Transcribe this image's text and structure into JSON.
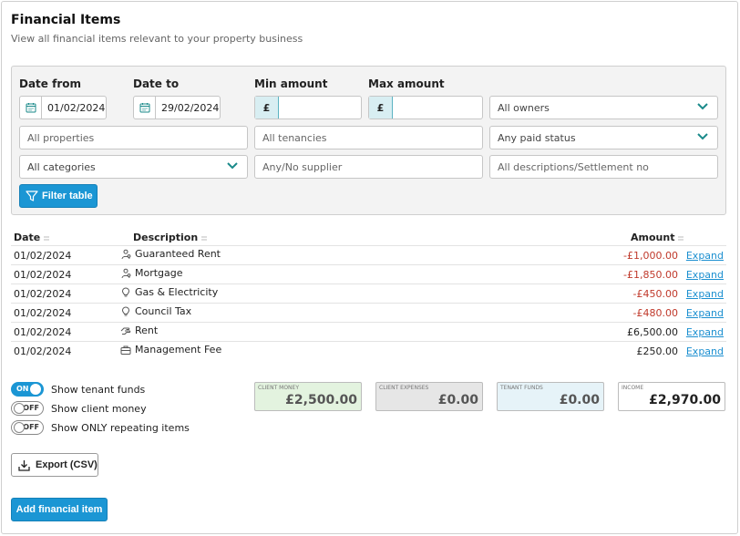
{
  "page": {
    "title": "Financial Items",
    "subtitle": "View all financial items relevant to your property business"
  },
  "filters": {
    "date_from_label": "Date from",
    "date_from_value": "01/02/2024",
    "date_to_label": "Date to",
    "date_to_value": "29/02/2024",
    "min_amount_label": "Min amount",
    "max_amount_label": "Max amount",
    "currency_symbol": "£",
    "owners_value": "All owners",
    "properties_placeholder": "All properties",
    "tenancies_placeholder": "All tenancies",
    "paid_status_value": "Any paid status",
    "categories_value": "All categories",
    "supplier_placeholder": "Any/No supplier",
    "descriptions_placeholder": "All descriptions/Settlement no",
    "filter_button": "Filter table"
  },
  "table": {
    "headers": {
      "date": "Date",
      "description": "Description",
      "amount": "Amount"
    },
    "expand_label": "Expand",
    "rows": [
      {
        "date": "01/02/2024",
        "description": "Guaranteed Rent",
        "icon": "people-icon",
        "amount": "-£1,000.00",
        "negative": true
      },
      {
        "date": "01/02/2024",
        "description": "Mortgage",
        "icon": "people-icon",
        "amount": "-£1,850.00",
        "negative": true
      },
      {
        "date": "01/02/2024",
        "description": "Gas & Electricity",
        "icon": "bulb-icon",
        "amount": "-£450.00",
        "negative": true
      },
      {
        "date": "01/02/2024",
        "description": "Council Tax",
        "icon": "bulb-icon",
        "amount": "-£480.00",
        "negative": true
      },
      {
        "date": "01/02/2024",
        "description": "Rent",
        "icon": "hand-icon",
        "amount": "£6,500.00",
        "negative": false
      },
      {
        "date": "01/02/2024",
        "description": "Management Fee",
        "icon": "briefcase-icon",
        "amount": "£250.00",
        "negative": false
      }
    ]
  },
  "toggles": [
    {
      "label": "Show tenant funds",
      "state": "ON",
      "on": true
    },
    {
      "label": "Show client money",
      "state": "OFF",
      "on": false
    },
    {
      "label": "Show ONLY repeating items",
      "state": "OFF",
      "on": false
    }
  ],
  "summary": [
    {
      "label": "CLIENT MONEY",
      "value": "£2,500.00",
      "bg": "#e3f3df",
      "fg": "#555555"
    },
    {
      "label": "CLIENT EXPENSES",
      "value": "£0.00",
      "bg": "#e6e6e6",
      "fg": "#555555"
    },
    {
      "label": "TENANT FUNDS",
      "value": "£0.00",
      "bg": "#e6f3f8",
      "fg": "#555555"
    },
    {
      "label": "INCOME",
      "value": "£2,970.00",
      "bg": "#ffffff",
      "fg": "#222222"
    }
  ],
  "actions": {
    "export_button": "Export (CSV)",
    "add_button": "Add financial item"
  },
  "colors": {
    "accent": "#1b96d4",
    "negative": "#c0392b",
    "chevron": "#1a8a8a"
  }
}
